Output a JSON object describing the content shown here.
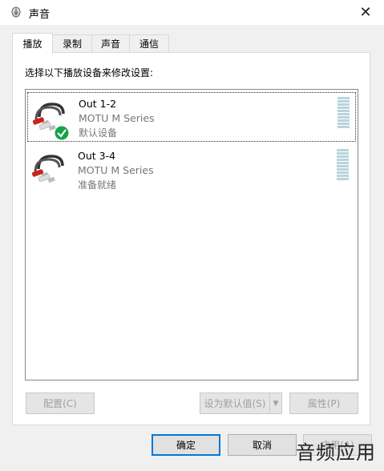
{
  "window": {
    "title": "声音"
  },
  "tabs": [
    {
      "label": "播放",
      "active": true
    },
    {
      "label": "录制",
      "active": false
    },
    {
      "label": "声音",
      "active": false
    },
    {
      "label": "通信",
      "active": false
    }
  ],
  "panel": {
    "instruction": "选择以下播放设备来修改设置:"
  },
  "devices": [
    {
      "name": "Out 1-2",
      "subtitle": "MOTU M Series",
      "status": "默认设备",
      "is_default": true,
      "selected": true
    },
    {
      "name": "Out 3-4",
      "subtitle": "MOTU M Series",
      "status": "准备就绪",
      "is_default": false,
      "selected": false
    }
  ],
  "panel_buttons": {
    "configure": "配置(C)",
    "set_default": "设为默认值(S)",
    "properties": "属性(P)"
  },
  "dialog_buttons": {
    "ok": "确定",
    "cancel": "取消",
    "apply": "应用(A)"
  },
  "watermark": "音频应用",
  "colors": {
    "accent": "#0078d7",
    "default_check": "#17a34a",
    "meter": "#b8d4dc"
  }
}
